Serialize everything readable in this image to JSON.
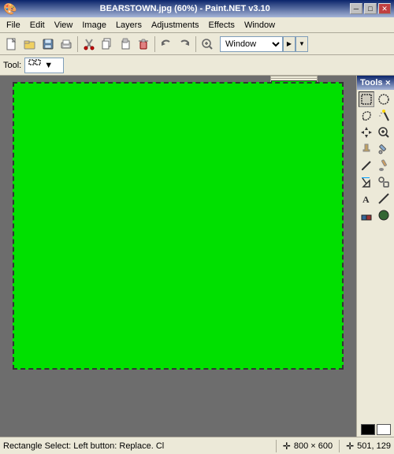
{
  "titlebar": {
    "title": "BEARSTOWN.jpg (60%) - Paint.NET v3.10",
    "min_label": "─",
    "max_label": "□",
    "close_label": "✕"
  },
  "menubar": {
    "items": [
      {
        "label": "File",
        "id": "file"
      },
      {
        "label": "Edit",
        "id": "edit"
      },
      {
        "label": "View",
        "id": "view"
      },
      {
        "label": "Image",
        "id": "image"
      },
      {
        "label": "Layers",
        "id": "layers"
      },
      {
        "label": "Adjustments",
        "id": "adjustments"
      },
      {
        "label": "Effects",
        "id": "effects"
      },
      {
        "label": "Window",
        "id": "window"
      }
    ]
  },
  "toolbar": {
    "buttons": [
      {
        "icon": "📄",
        "name": "new",
        "label": "New"
      },
      {
        "icon": "📂",
        "name": "open",
        "label": "Open"
      },
      {
        "icon": "💾",
        "name": "save",
        "label": "Save"
      },
      {
        "icon": "🖨",
        "name": "print",
        "label": "Print"
      },
      {
        "icon": "✂",
        "name": "cut",
        "label": "Cut"
      },
      {
        "icon": "📋",
        "name": "copy",
        "label": "Copy"
      },
      {
        "icon": "📌",
        "name": "paste",
        "label": "Paste"
      },
      {
        "icon": "🗑",
        "name": "delete",
        "label": "Delete"
      },
      {
        "icon": "⟲",
        "name": "undo",
        "label": "Undo"
      },
      {
        "icon": "⟳",
        "name": "redo",
        "label": "Redo"
      },
      {
        "icon": "🔍",
        "name": "zoom",
        "label": "Zoom"
      },
      {
        "icon": "W",
        "name": "window-btn",
        "label": "Window"
      }
    ],
    "window_select": "Window"
  },
  "tool_row": {
    "label": "Tool:",
    "current_tool": "▦"
  },
  "tools_panel": {
    "title": "Tools",
    "close_label": "✕",
    "tools": [
      {
        "icon": "⊞",
        "name": "rectangle-select"
      },
      {
        "icon": "⊙",
        "name": "ellipse-select"
      },
      {
        "icon": "⬡",
        "name": "lasso-select"
      },
      {
        "icon": "✦",
        "name": "magic-wand"
      },
      {
        "icon": "↔",
        "name": "move-tool"
      },
      {
        "icon": "🔍",
        "name": "zoom-tool"
      },
      {
        "icon": "✋",
        "name": "pan-tool"
      },
      {
        "icon": "🖊",
        "name": "pencil"
      },
      {
        "icon": "🖌",
        "name": "paint-brush"
      },
      {
        "icon": "⊘",
        "name": "eraser"
      },
      {
        "icon": "🪣",
        "name": "fill"
      },
      {
        "icon": "▭",
        "name": "rectangle-shape"
      },
      {
        "icon": "◯",
        "name": "ellipse-shape"
      },
      {
        "icon": "A",
        "name": "text-tool"
      },
      {
        "icon": "⟋",
        "name": "line-tool"
      },
      {
        "icon": "◻",
        "name": "rounded-rect"
      },
      {
        "icon": "◼",
        "name": "shape-3d"
      },
      {
        "icon": "◈",
        "name": "shape-extra"
      }
    ],
    "colors": {
      "primary": "#000000",
      "secondary": "#ffffff",
      "extra1": "#808080",
      "extra2": "#c0c0c0"
    }
  },
  "canvas": {
    "bg_color": "#00e000",
    "border_style": "dashed"
  },
  "statusbar": {
    "message": "Rectangle Select: Left button: Replace. Cl",
    "cursor_icon": "✛",
    "dimensions": "800 × 600",
    "position_icon": "✛",
    "position": "501, 129"
  }
}
